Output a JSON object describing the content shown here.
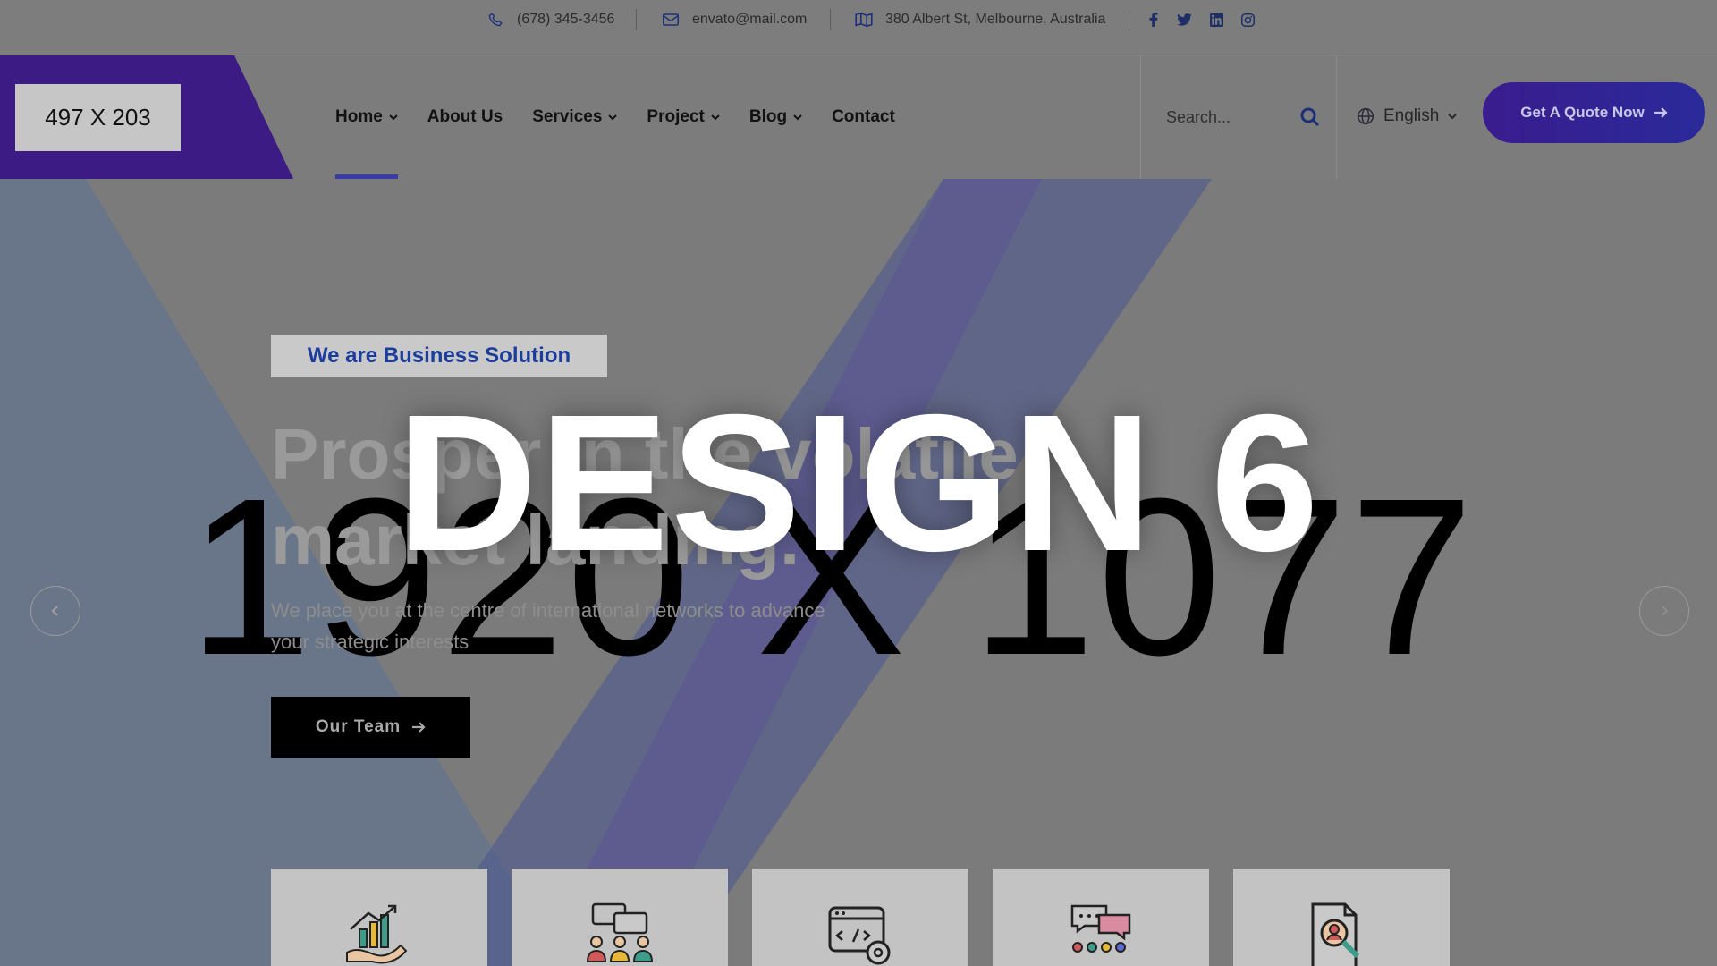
{
  "topbar": {
    "phone": "(678) 345-3456",
    "email": "envato@mail.com",
    "address": "380 Albert St, Melbourne, Australia",
    "icons": [
      "phone-icon",
      "mail-icon",
      "map-icon",
      "facebook-icon",
      "twitter-icon",
      "linkedin-icon",
      "instagram-icon"
    ]
  },
  "header": {
    "logo_placeholder": "497 X 203",
    "nav": [
      {
        "label": "Home",
        "has_dropdown": true,
        "active": true
      },
      {
        "label": "About Us",
        "has_dropdown": false
      },
      {
        "label": "Services",
        "has_dropdown": true
      },
      {
        "label": "Project",
        "has_dropdown": true
      },
      {
        "label": "Blog",
        "has_dropdown": true
      },
      {
        "label": "Contact",
        "has_dropdown": false
      }
    ],
    "search_placeholder": "Search...",
    "language": "English",
    "quote_button": "Get A Quote Now"
  },
  "hero": {
    "tagline": "We are Business Solution",
    "headline": "Prosper in the volatile market landing.",
    "subtext": "We place you at the centre of international networks to advance your strategic interests",
    "button": "Our Team",
    "image_placeholder": "1920 X 1077",
    "overlay_label": "DESIGN 6"
  },
  "service_cards": [
    "growth-icon",
    "meeting-icon",
    "code-settings-icon",
    "team-chat-icon",
    "search-user-icon"
  ],
  "colors": {
    "brand": "#3a1c8e",
    "accent_blue": "#1d3d9c",
    "active_nav": "#3a3aa8"
  }
}
